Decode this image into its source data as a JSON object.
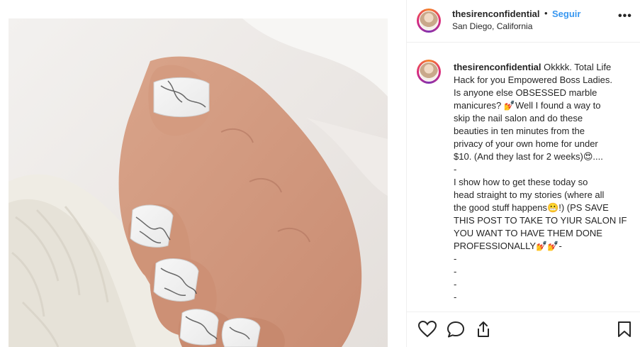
{
  "post": {
    "image_alt": "Marble nail manicure photo",
    "username": "thesirenconfidential",
    "follow_label": "Seguir",
    "location": "San Diego, California",
    "more_label": "•••",
    "caption_lines": [
      "Okkkk. Total Life",
      "Hack for you Empowered Boss Ladies.",
      "Is anyone else OBSESSED marble",
      "manicures? 💅Well I found a way to",
      "skip the nail salon and do these",
      "beauties in ten minutes from the",
      "privacy of your own home for under",
      "$10. (And they last for 2 weeks)😍....",
      "-",
      "I show how to get these today so",
      "head straight to my stories (where all",
      "the good stuff happens😬!) (PS SAVE",
      "THIS POST TO TAKE TO YIUR SALON IF",
      "YOU WANT TO HAVE THEM DONE",
      "PROFESSIONALLY💅💅-",
      "-",
      "-",
      "-",
      "-"
    ],
    "icons": {
      "like": "heart-icon",
      "comment": "comment-icon",
      "share": "share-icon",
      "save": "bookmark-icon"
    },
    "colors": {
      "link_blue": "#3897f0",
      "text": "#262626",
      "border": "#efefef"
    }
  }
}
